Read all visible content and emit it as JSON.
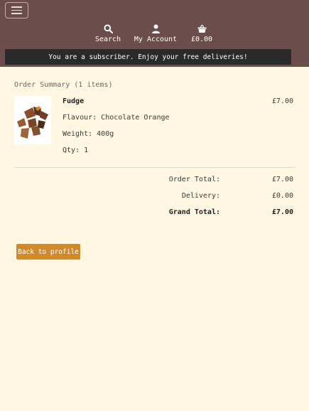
{
  "header": {
    "nav": {
      "search_label": "Search",
      "account_label": "My Account",
      "basket_total": "£0.00"
    },
    "banner": "You are a subscriber. Enjoy your free deliveries!"
  },
  "order": {
    "summary_title": "Order Summary (1 items)",
    "items": [
      {
        "name": "Fudge",
        "price": "£7.00",
        "flavour": "Flavour: Chocolate Orange",
        "weight": "Weight: 400g",
        "qty": "Qty: 1"
      }
    ],
    "totals": {
      "order_total_label": "Order Total:",
      "order_total": "£7.00",
      "delivery_label": "Delivery:",
      "delivery": "£0.00",
      "grand_total_label": "Grand Total:",
      "grand_total": "£7.00"
    }
  },
  "actions": {
    "back_label": "Back to profile"
  }
}
